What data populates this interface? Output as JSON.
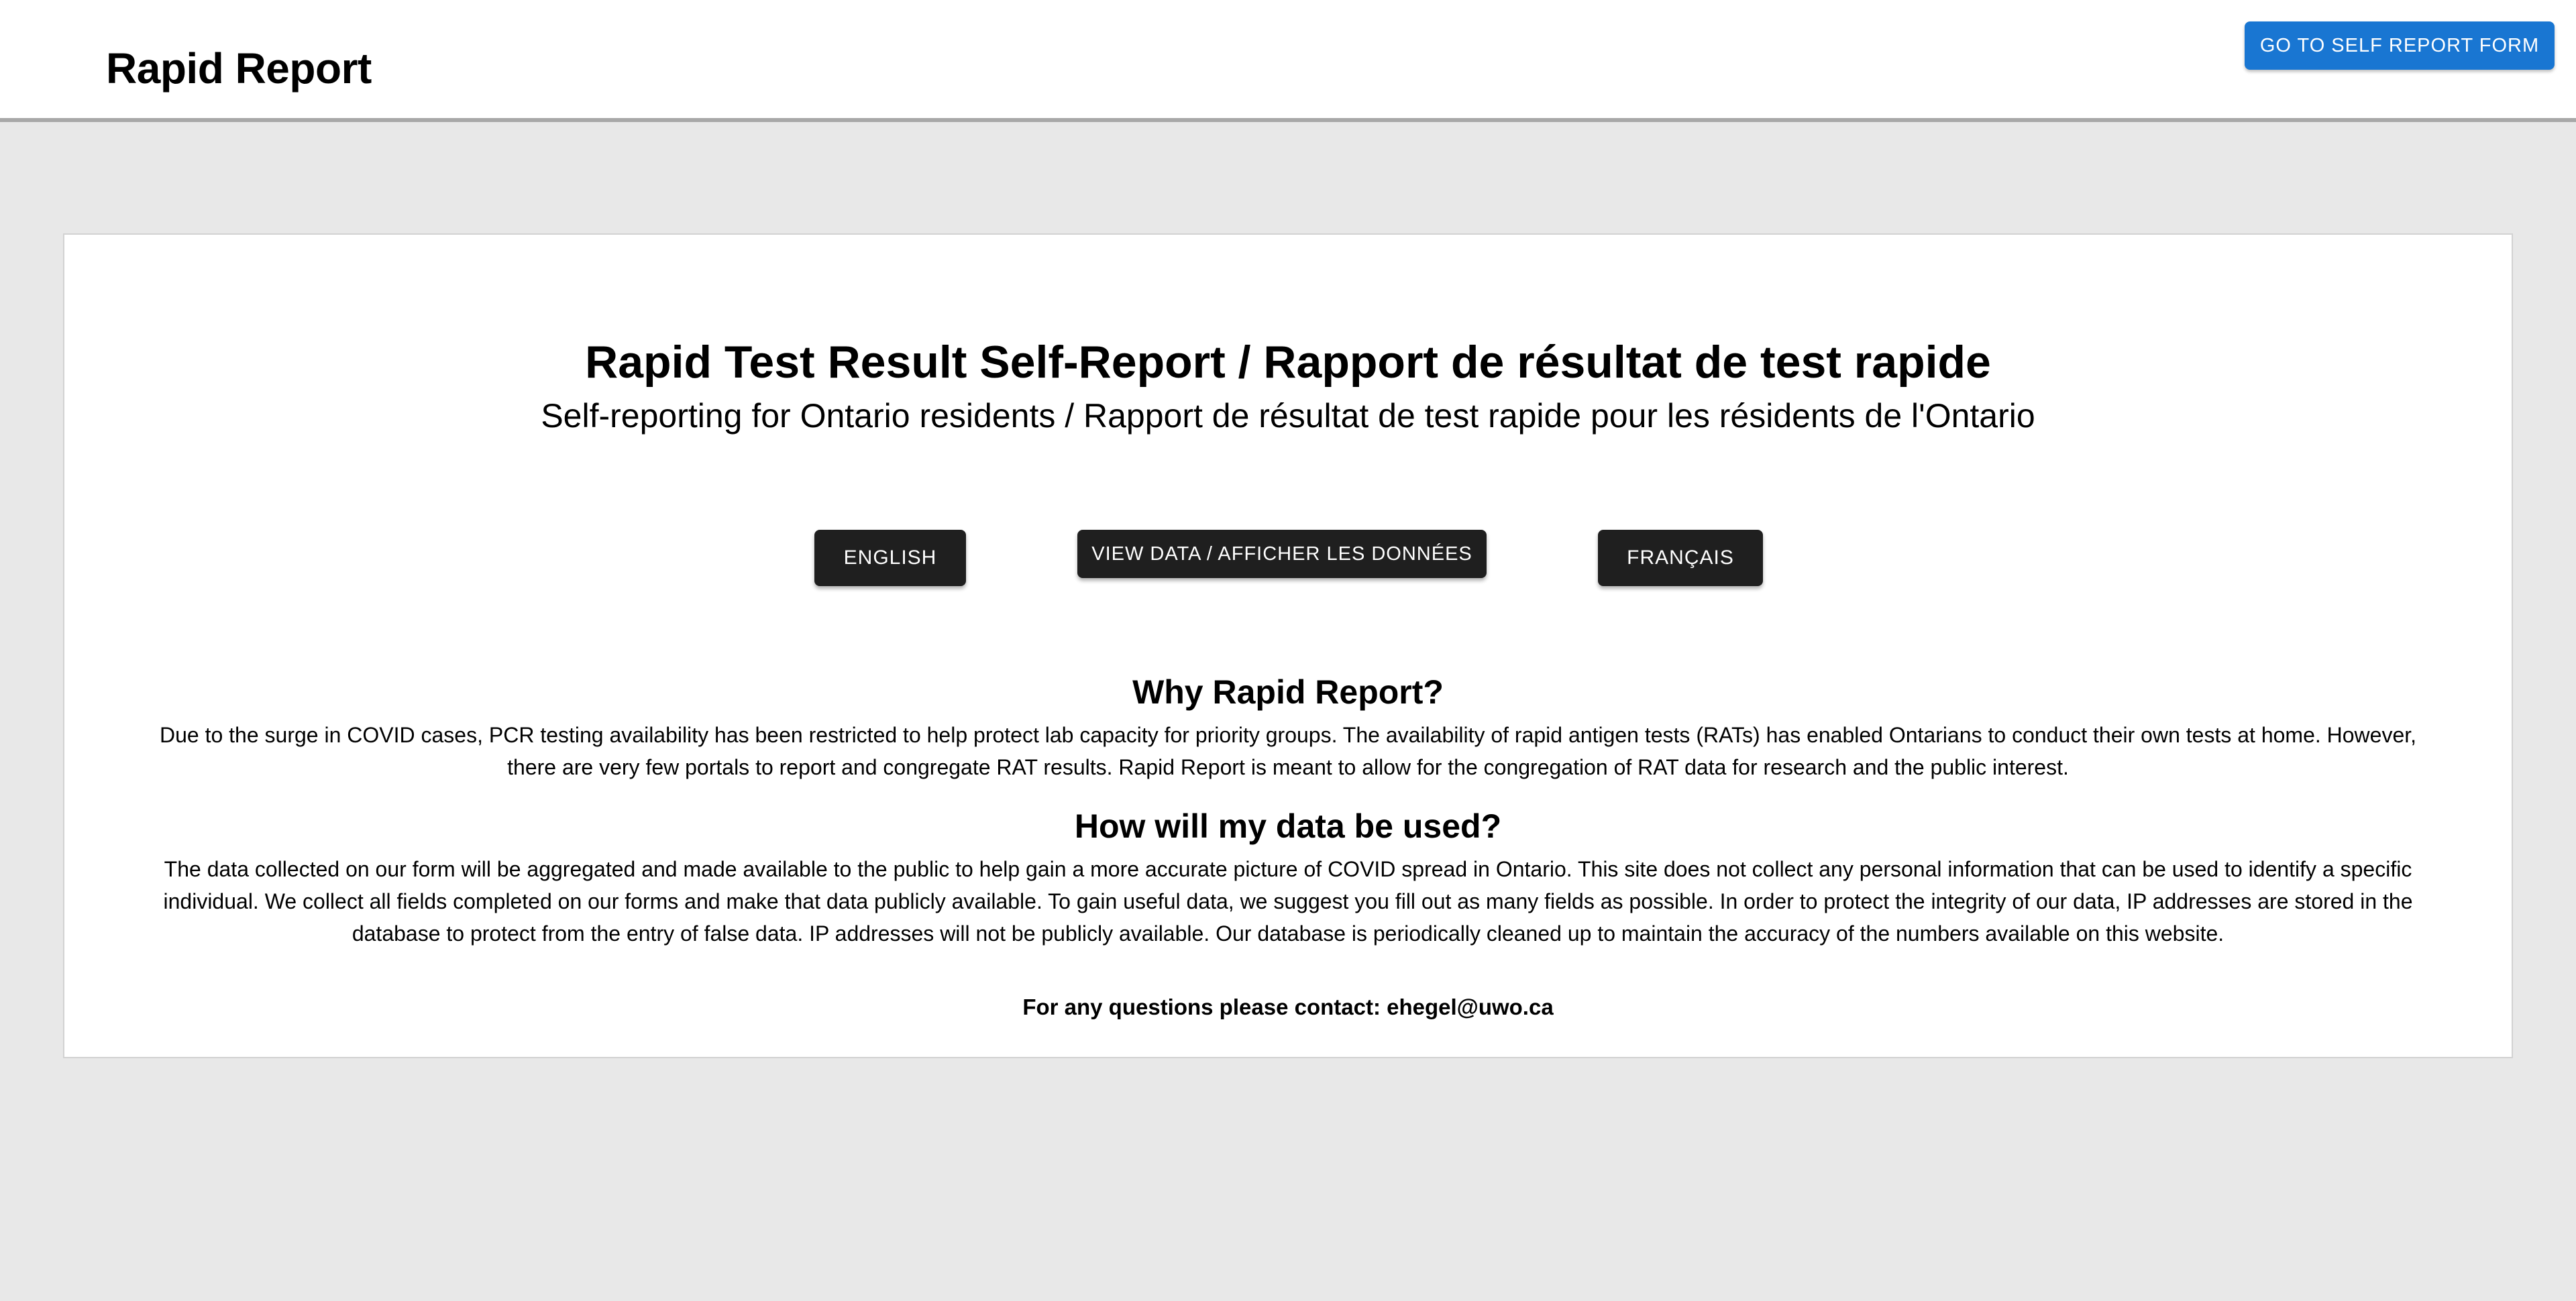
{
  "header": {
    "brand": "Rapid Report",
    "cta_label": "GO TO SELF REPORT FORM"
  },
  "main": {
    "title": "Rapid Test Result Self-Report / Rapport de résultat de test rapide",
    "subtitle": "Self-reporting for Ontario residents / Rapport de résultat de test rapide pour les résidents de l'Ontario",
    "buttons": {
      "english": "ENGLISH",
      "view_data": "VIEW DATA / AFFICHER LES DONNÉES",
      "french": "FRANÇAIS"
    },
    "sections": [
      {
        "heading": "Why Rapid Report?",
        "body": "Due to the surge in COVID cases, PCR testing availability has been restricted to help protect lab capacity for priority groups. The availability of rapid antigen tests (RATs) has enabled Ontarians to conduct their own tests at home. However, there are very few portals to report and congregate RAT results. Rapid Report is meant to allow for the congregation of RAT data for research and the public interest."
      },
      {
        "heading": "How will my data be used?",
        "body": "The data collected on our form will be aggregated and made available to the public to help gain a more accurate picture of COVID spread in Ontario. This site does not collect any personal information that can be used to identify a specific individual. We collect all fields completed on our forms and make that data publicly available. To gain useful data, we suggest you fill out as many fields as possible. In order to protect the integrity of our data, IP addresses are stored in the database to protect from the entry of false data. IP addresses will not be publicly available. Our database is periodically cleaned up to maintain the accuracy of the numbers available on this website."
      }
    ],
    "contact": "For any questions please contact: ehegel@uwo.ca"
  },
  "colors": {
    "primary_button": "#1976d2",
    "dark_button": "#1f1f1f",
    "page_background": "#e8e8e8",
    "card_background": "#ffffff"
  }
}
